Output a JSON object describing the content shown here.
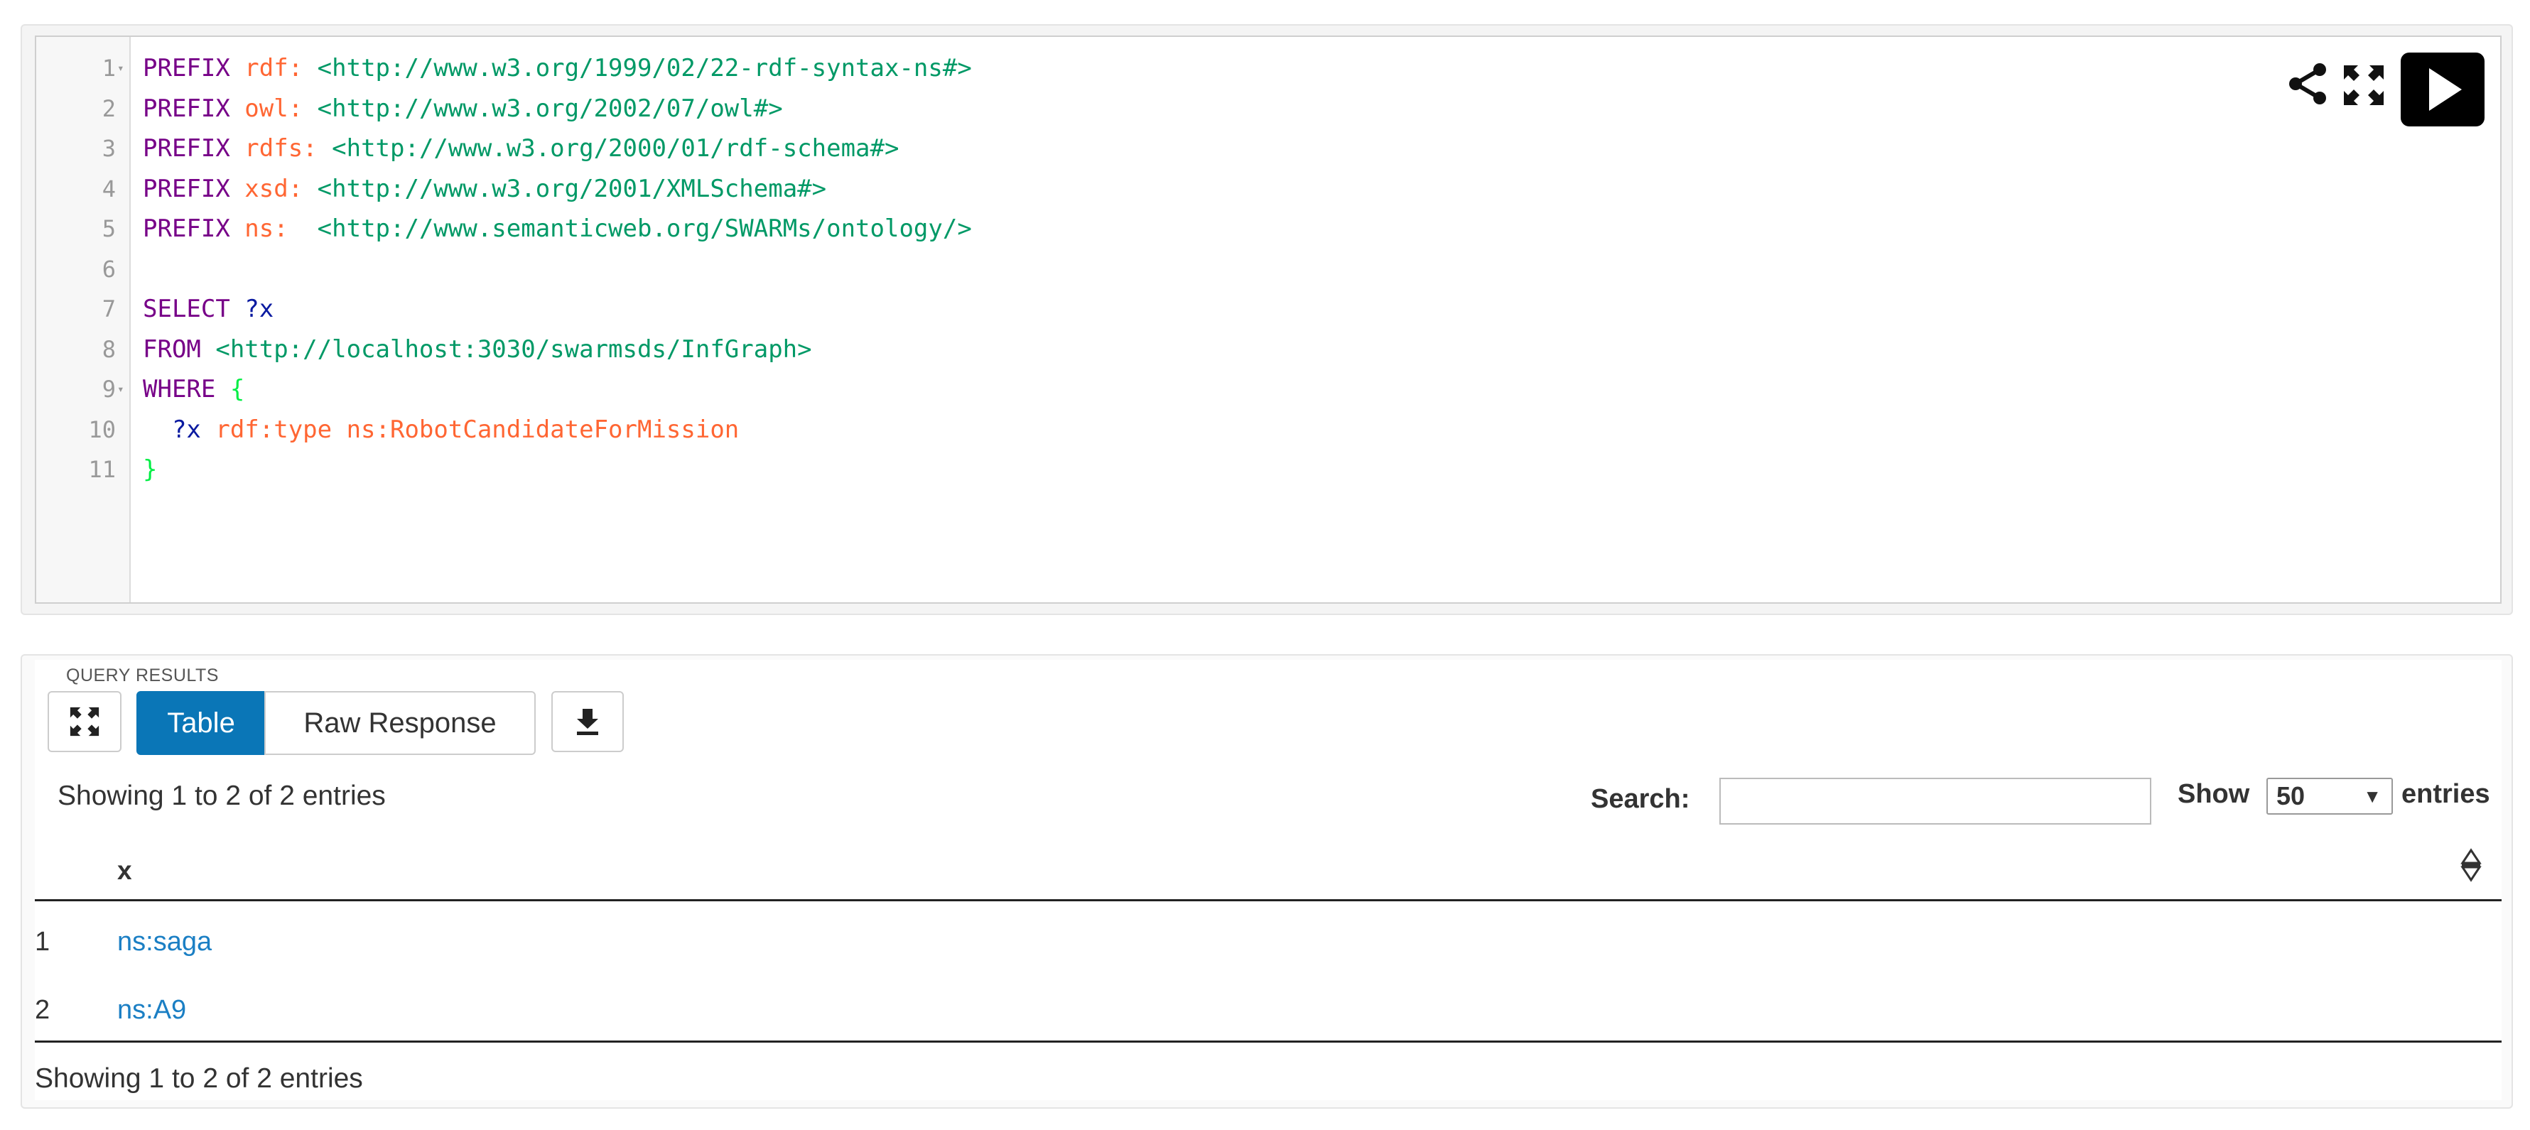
{
  "editor": {
    "lines": [
      {
        "n": "1",
        "fold": "▾",
        "parts": [
          {
            "t": "PREFIX",
            "c": "kw"
          },
          {
            "t": " rdf:",
            "c": "pf"
          },
          {
            "t": " <http://www.w3.org/1999/02/22-rdf-syntax-ns#>",
            "c": "iri"
          }
        ]
      },
      {
        "n": "2",
        "fold": "",
        "parts": [
          {
            "t": "PREFIX",
            "c": "kw"
          },
          {
            "t": " owl:",
            "c": "pf"
          },
          {
            "t": " <http://www.w3.org/2002/07/owl#>",
            "c": "iri"
          }
        ]
      },
      {
        "n": "3",
        "fold": "",
        "parts": [
          {
            "t": "PREFIX",
            "c": "kw"
          },
          {
            "t": " rdfs:",
            "c": "pf"
          },
          {
            "t": " <http://www.w3.org/2000/01/rdf-schema#>",
            "c": "iri"
          }
        ]
      },
      {
        "n": "4",
        "fold": "",
        "parts": [
          {
            "t": "PREFIX",
            "c": "kw"
          },
          {
            "t": " xsd:",
            "c": "pf"
          },
          {
            "t": " <http://www.w3.org/2001/XMLSchema#>",
            "c": "iri"
          }
        ]
      },
      {
        "n": "5",
        "fold": "",
        "parts": [
          {
            "t": "PREFIX",
            "c": "kw"
          },
          {
            "t": " ns:",
            "c": "pf"
          },
          {
            "t": "  <http://www.semanticweb.org/SWARMs/ontology/>",
            "c": "iri"
          }
        ]
      },
      {
        "n": "6",
        "fold": "",
        "parts": []
      },
      {
        "n": "7",
        "fold": "",
        "parts": [
          {
            "t": "SELECT",
            "c": "kw"
          },
          {
            "t": " ?x",
            "c": "var"
          }
        ]
      },
      {
        "n": "8",
        "fold": "",
        "parts": [
          {
            "t": "FROM",
            "c": "kw"
          },
          {
            "t": " <http://localhost:3030/swarmsds/InfGraph>",
            "c": "iri"
          }
        ]
      },
      {
        "n": "9",
        "fold": "▾",
        "parts": [
          {
            "t": "WHERE",
            "c": "kw"
          },
          {
            "t": " {",
            "c": "brace"
          }
        ]
      },
      {
        "n": "10",
        "fold": "",
        "parts": [
          {
            "t": "  ?x",
            "c": "var"
          },
          {
            "t": " rdf:type ns:RobotCandidateForMission",
            "c": "pf"
          }
        ]
      },
      {
        "n": "11",
        "fold": "",
        "parts": [
          {
            "t": "}",
            "c": "brace"
          }
        ]
      }
    ],
    "tools": {
      "share_icon": "share-icon",
      "fullscreen_icon": "fullscreen-icon",
      "run_icon": "play-icon"
    }
  },
  "results": {
    "label": "QUERY RESULTS",
    "tabs": {
      "table": "Table",
      "raw": "Raw Response"
    },
    "info_top": "Showing 1 to 2 of 2 entries",
    "search_label": "Search:",
    "search_value": "",
    "show_label": "Show",
    "length_value": "50",
    "entries_label": "entries",
    "column": "x",
    "rows": [
      {
        "index": "1",
        "value": "ns:saga"
      },
      {
        "index": "2",
        "value": "ns:A9"
      }
    ],
    "info_bottom": "Showing 1 to 2 of 2 entries"
  },
  "colors": {
    "accent": "#0a76b7",
    "link": "#1b7fc4",
    "keyword": "#770088",
    "prefix": "#ff6633",
    "iri": "#009966"
  }
}
